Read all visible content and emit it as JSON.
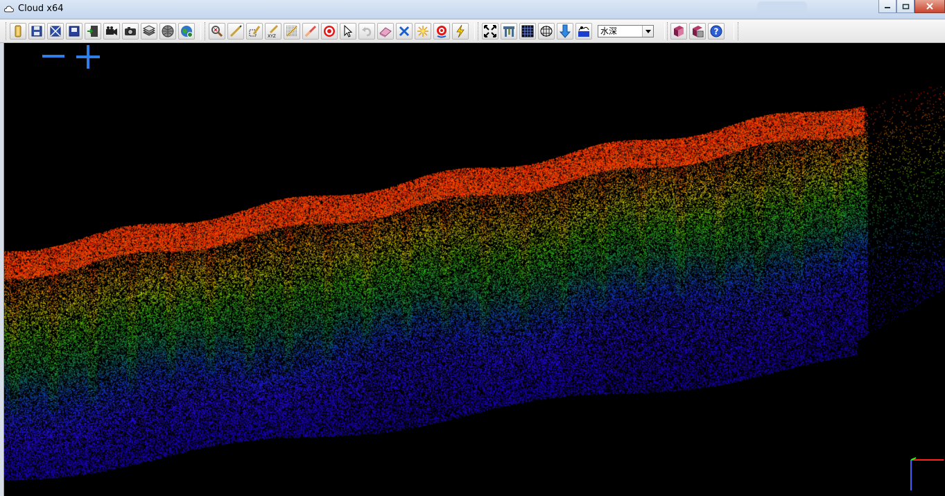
{
  "window": {
    "title": "Cloud x64",
    "controls": [
      "minimize-icon",
      "maximize-icon",
      "close-icon"
    ]
  },
  "toolbar": {
    "groups": [
      [
        "open-file-icon",
        "save-icon",
        "export-icon",
        "save-as-icon",
        "exit-icon",
        "camera-record-icon",
        "screenshot-icon",
        "layers-icon",
        "sphere-icon",
        "globe-icon"
      ],
      [
        "inspect-icon",
        "measure-line-icon",
        "measure-area-icon",
        "xyz-coordinate-icon",
        "color-ramp-icon",
        "gradient-line-icon",
        "target-icon",
        "select-pointer-icon",
        "undo-icon",
        "eraser-icon",
        "delete-cross-icon",
        "sparkle-icon",
        "rotate-target-icon",
        "lightning-icon"
      ],
      [
        "fit-view-icon",
        "profile-icon",
        "grid-display-icon",
        "mesh-grid-icon",
        "arrow-down-icon",
        "water-depth-icon"
      ],
      [
        "manual-book-icon",
        "settings-book-icon",
        "help-icon"
      ]
    ],
    "render_mode": {
      "selected": "水深"
    }
  },
  "viewport": {
    "zoom_out_icon": "minus-icon",
    "zoom_in_icon": "plus-icon",
    "color_scale": [
      "#ff1a00",
      "#ff7a00",
      "#e8d600",
      "#3fcc12",
      "#1a9a56",
      "#1544d6",
      "#2a10f5",
      "#1d00d6"
    ],
    "axis_colors": {
      "x": "#ff2020",
      "y": "#20ff20",
      "z": "#4060ff"
    }
  }
}
